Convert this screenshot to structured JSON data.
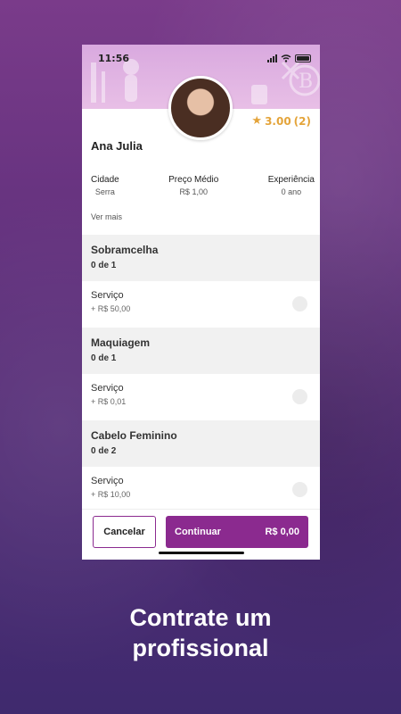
{
  "status_bar": {
    "time": "11:56"
  },
  "profile": {
    "name": "Ana Julia",
    "rating": "3.00",
    "rating_count": "(2)",
    "info": [
      {
        "label": "Cidade",
        "value": "Serra"
      },
      {
        "label": "Preço Médio",
        "value": "R$ 1,00"
      },
      {
        "label": "Experiência",
        "value": "0 ano"
      }
    ],
    "see_more": "Ver mais"
  },
  "sections": [
    {
      "title": "Sobramcelha",
      "count": "0 de 1",
      "service": "Serviço",
      "price": "+ R$ 50,00"
    },
    {
      "title": "Maquiagem",
      "count": "0 de 1",
      "service": "Serviço",
      "price": "+ R$ 0,01"
    },
    {
      "title": "Cabelo Feminino",
      "count": "0 de 2",
      "service": "Serviço",
      "price": "+ R$ 10,00"
    }
  ],
  "footer": {
    "cancel_label": "Cancelar",
    "continue_label": "Continuar",
    "total": "R$ 0,00"
  },
  "caption": {
    "line1": "Contrate um",
    "line2": "profissional"
  },
  "colors": {
    "accent": "#8b2a8f",
    "star": "#e4a43a",
    "header": "#e2b5e3"
  }
}
